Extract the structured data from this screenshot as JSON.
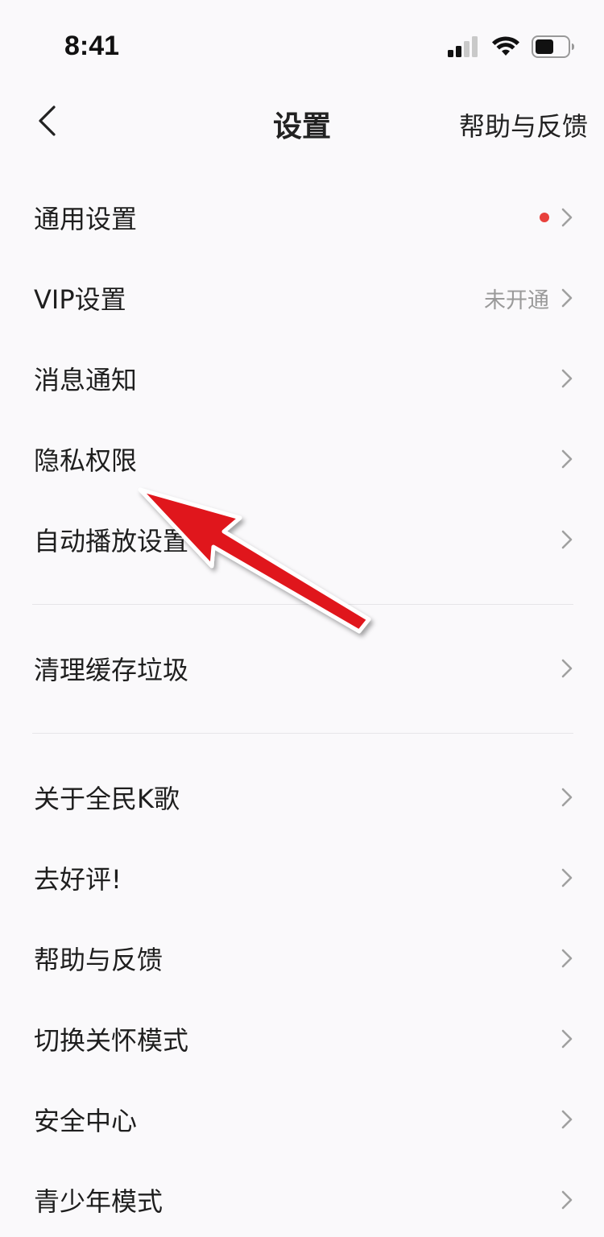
{
  "status": {
    "time": "8:41"
  },
  "nav": {
    "title": "设置",
    "right_label": "帮助与反馈"
  },
  "colors": {
    "accent_dot": "#e8413c",
    "annotation_arrow": "#e0141c",
    "background": "#faf9fb"
  },
  "groups": [
    [
      {
        "label": "通用设置",
        "value": "",
        "dot": true
      },
      {
        "label": "VIP设置",
        "value": "未开通",
        "dot": false
      },
      {
        "label": "消息通知",
        "value": "",
        "dot": false
      },
      {
        "label": "隐私权限",
        "value": "",
        "dot": false
      },
      {
        "label": "自动播放设置",
        "value": "",
        "dot": false
      }
    ],
    [
      {
        "label": "清理缓存垃圾",
        "value": "",
        "dot": false
      }
    ],
    [
      {
        "label": "关于全民K歌",
        "value": "",
        "dot": false
      },
      {
        "label": "去好评!",
        "value": "",
        "dot": false
      },
      {
        "label": "帮助与反馈",
        "value": "",
        "dot": false
      },
      {
        "label": "切换关怀模式",
        "value": "",
        "dot": false
      },
      {
        "label": "安全中心",
        "value": "",
        "dot": false
      },
      {
        "label": "青少年模式",
        "value": "",
        "dot": false
      }
    ]
  ]
}
